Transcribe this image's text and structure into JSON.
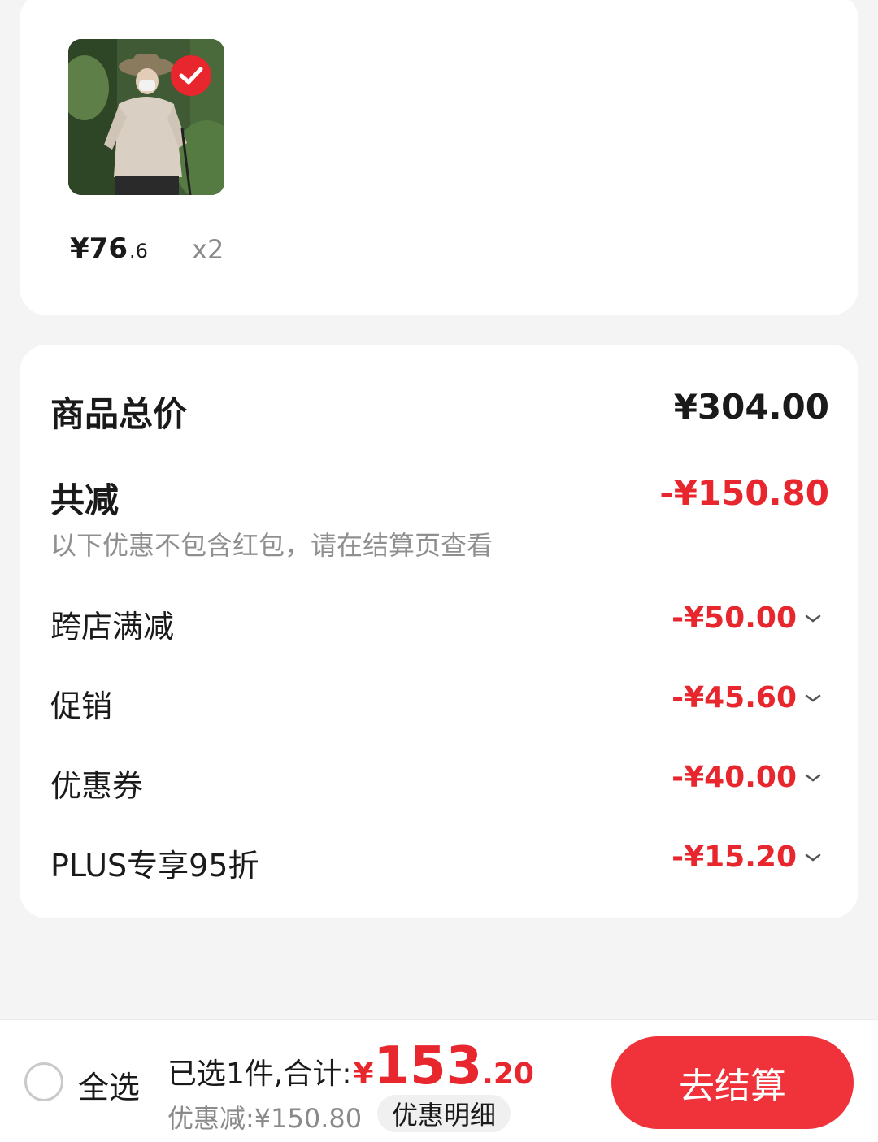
{
  "product": {
    "image_icon": "product-photo-hiking-jacket",
    "selected_icon": "check-circle-icon",
    "price_main": "¥76",
    "price_decimal": ".6",
    "quantity": "x2"
  },
  "summary": {
    "total_label": "商品总价",
    "total_value": "¥304.00",
    "reduce_label": "共减",
    "reduce_value": "-¥150.80",
    "hint": "以下优惠不包含红包，请在结算页查看",
    "discounts": [
      {
        "label": "跨店满减",
        "amount": "-¥50.00"
      },
      {
        "label": "促销",
        "amount": "-¥45.60"
      },
      {
        "label": "优惠券",
        "amount": "-¥40.00"
      },
      {
        "label": "PLUS专享95折",
        "amount": "-¥15.20"
      }
    ]
  },
  "bottom": {
    "select_all": "全选",
    "selected_text": "已选1件,合计:",
    "total_yen": "¥",
    "total_int": "153",
    "total_dec": ".20",
    "saved_text": "优惠减:¥150.80",
    "detail_button": "优惠明细",
    "checkout_button": "去结算"
  },
  "colors": {
    "accent_red": "#e8262e",
    "checkout_red": "#f0323a",
    "background": "#f4f4f4"
  }
}
